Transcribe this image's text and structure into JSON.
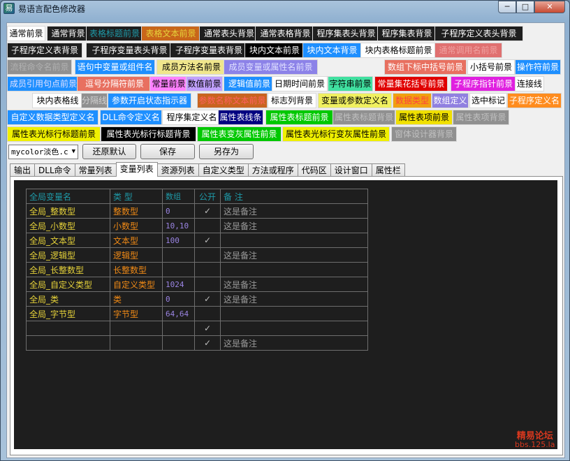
{
  "window": {
    "title": "易语言配色修改器",
    "min": "─",
    "max": "□",
    "close": "✕",
    "icon": "app-icon"
  },
  "swatches": [
    {
      "label": "通常前景",
      "fg": "#000000",
      "bg": "#ffffff"
    },
    {
      "label": "通常背景",
      "fg": "#ffffff",
      "bg": "#1e1e1e"
    },
    {
      "label": "表格标题前景",
      "fg": "#1e9aa8",
      "bg": "#1e1e1e"
    },
    {
      "label": "表格文本前景",
      "fg": "#e6d23a",
      "bg": "#c8661a"
    },
    {
      "label": "通常表头背景",
      "fg": "#ffffff",
      "bg": "#1e1e1e"
    },
    {
      "label": "通常表格背景",
      "fg": "#ffffff",
      "bg": "#1e1e1e"
    },
    {
      "label": "程序集表头背景",
      "fg": "#ffffff",
      "bg": "#1e1e1e"
    },
    {
      "label": "程序集表背景",
      "fg": "#ffffff",
      "bg": "#1e1e1e"
    },
    {
      "label": "子程序定义表头背景",
      "fg": "#ffffff",
      "bg": "#1e1e1e"
    },
    {
      "label": "子程序定义表背景",
      "fg": "#ffffff",
      "bg": "#1e1e1e"
    },
    {
      "label": "子程序变量表头背景",
      "fg": "#ffffff",
      "bg": "#1e1e1e"
    },
    {
      "label": "子程序变量表背景",
      "fg": "#ffffff",
      "bg": "#1e1e1e"
    },
    {
      "label": "块内文本前景",
      "fg": "#ffffff",
      "bg": "#000000"
    },
    {
      "label": "块内文本背景",
      "fg": "#ffffff",
      "bg": "#1e8fff"
    },
    {
      "label": "块内表格标题前景",
      "fg": "#000000",
      "bg": "#ffffff"
    },
    {
      "label": "通常调用名前景",
      "fg": "#f0a0a0",
      "bg": "#e07070"
    },
    {
      "label": "流程命令名前景",
      "fg": "#b0b0b0",
      "bg": "#909090"
    },
    {
      "label": "语句中变量或组件名",
      "fg": "#ffffff",
      "bg": "#1e8fff"
    },
    {
      "label": "成员方法名前景",
      "fg": "#000000",
      "bg": "#f0e68c"
    },
    {
      "label": "成员变量或属性名前景",
      "fg": "#e0e0ff",
      "bg": "#8c82e8"
    },
    {
      "label": "数组下标中括号前景",
      "fg": "#ffffff",
      "bg": "#e87060"
    },
    {
      "label": "小括号前景",
      "fg": "#000000",
      "bg": "#ffffff"
    },
    {
      "label": "操作符前景",
      "fg": "#ffffff",
      "bg": "#1e8fff"
    },
    {
      "label": "成员引用句点前景",
      "fg": "#e0e0ff",
      "bg": "#1e8fff"
    },
    {
      "label": "逗号分隔符前景",
      "fg": "#ffffff",
      "bg": "#e87060"
    },
    {
      "label": "常量前景",
      "fg": "#000000",
      "bg": "#ff80ff"
    },
    {
      "label": "数值前景",
      "fg": "#000000",
      "bg": "#c0a0ff"
    },
    {
      "label": "逻辑值前景",
      "fg": "#ffffff",
      "bg": "#1e8fff"
    },
    {
      "label": "日期时间前景",
      "fg": "#000000",
      "bg": "#ffffff"
    },
    {
      "label": "字符串前景",
      "fg": "#000000",
      "bg": "#40e0a0"
    },
    {
      "label": "常量集花括号前景",
      "fg": "#ffffff",
      "bg": "#e00000"
    },
    {
      "label": "子程序指针前景",
      "fg": "#ffffff",
      "bg": "#e020e0"
    },
    {
      "label": "连接线",
      "fg": "#000000",
      "bg": "#ffffff"
    },
    {
      "label": "块内表格线",
      "fg": "#000000",
      "bg": "#ffffff"
    },
    {
      "label": "分隔线",
      "fg": "#d0d0d0",
      "bg": "#909090"
    },
    {
      "label": "参数开启状态指示器",
      "fg": "#ffffff",
      "bg": "#1e8fff"
    },
    {
      "label": "参数名称文本前景",
      "fg": "#ff6060",
      "bg": "#c86420"
    },
    {
      "label": "标志列背景",
      "fg": "#000000",
      "bg": "#ffffff"
    },
    {
      "label": "变量或参数定义名",
      "fg": "#000000",
      "bg": "#f0f060"
    },
    {
      "label": "数据类型",
      "fg": "#ff4040",
      "bg": "#f0a010"
    },
    {
      "label": "数组定义",
      "fg": "#ffffff",
      "bg": "#9080e0"
    },
    {
      "label": "选中标记",
      "fg": "#000000",
      "bg": "#ffffff"
    },
    {
      "label": "子程序定义名",
      "fg": "#ffffff",
      "bg": "#ff8c1e"
    },
    {
      "label": "自定义数据类型定义名",
      "fg": "#ffffff",
      "bg": "#1e8fff"
    },
    {
      "label": "DLL命令定义名",
      "fg": "#ffffff",
      "bg": "#1e8fff"
    },
    {
      "label": "程序集定义名",
      "fg": "#000000",
      "bg": "#ffffff"
    },
    {
      "label": "属性表线条",
      "fg": "#ffffff",
      "bg": "#000080"
    },
    {
      "label": "属性表标题前景",
      "fg": "#ffffff",
      "bg": "#00c800"
    },
    {
      "label": "属性表标题背景",
      "fg": "#c0c0c0",
      "bg": "#909090"
    },
    {
      "label": "属性表项前景",
      "fg": "#000000",
      "bg": "#f0e000"
    },
    {
      "label": "属性表项背景",
      "fg": "#c0c0c0",
      "bg": "#909090"
    },
    {
      "label": "属性表光标行标题前景",
      "fg": "#000000",
      "bg": "#f0f000"
    },
    {
      "label": "属性表光标行标题背景",
      "fg": "#ffffff",
      "bg": "#000000"
    },
    {
      "label": "属性表变灰属性前景",
      "fg": "#ffffff",
      "bg": "#00c800"
    },
    {
      "label": "属性表光标行变灰属性前景",
      "fg": "#000000",
      "bg": "#f0f000"
    },
    {
      "label": "窗体设计器背景",
      "fg": "#c0c0c0",
      "bg": "#909090"
    }
  ],
  "controls": {
    "scheme": "mycolor淡色.c",
    "scheme_arrow": "▼",
    "reset": "还原默认",
    "save": "保存",
    "save_as": "另存为"
  },
  "tabs": [
    "输出",
    "DLL命令",
    "常量列表",
    "变量列表",
    "资源列表",
    "自定义类型",
    "方法或程序",
    "代码区",
    "设计窗口",
    "属性栏"
  ],
  "active_tab": "变量列表",
  "var_table": {
    "headers": [
      "全局变量名",
      "类 型",
      "数组",
      "公开",
      "备 注"
    ],
    "rows": [
      {
        "name": "全局_整数型",
        "type": "整数型",
        "array": "0",
        "public": "✓",
        "note": "这是备注"
      },
      {
        "name": "全局_小数型",
        "type": "小数型",
        "array": "10,10",
        "public": "",
        "note": "这是备注"
      },
      {
        "name": "全局_文本型",
        "type": "文本型",
        "array": "100",
        "public": "✓",
        "note": ""
      },
      {
        "name": "全局_逻辑型",
        "type": "逻辑型",
        "array": "",
        "public": "",
        "note": "这是备注"
      },
      {
        "name": "全局_长整数型",
        "type": "长整数型",
        "array": "",
        "public": "",
        "note": ""
      },
      {
        "name": "全局_自定义类型",
        "type": "自定义类型",
        "array": "1024",
        "public": "",
        "note": "这是备注"
      },
      {
        "name": "全局_类",
        "type": "类",
        "array": "0",
        "public": "✓",
        "note": "这是备注"
      },
      {
        "name": "全局_字节型",
        "type": "字节型",
        "array": "64,64",
        "public": "",
        "note": ""
      },
      {
        "name": "",
        "type": "",
        "array": "",
        "public": "✓",
        "note": ""
      },
      {
        "name": "",
        "type": "",
        "array": "",
        "public": "✓",
        "note": "这是备注"
      }
    ]
  },
  "watermark": {
    "line1": "精易论坛",
    "line2": "bbs.125.la"
  }
}
